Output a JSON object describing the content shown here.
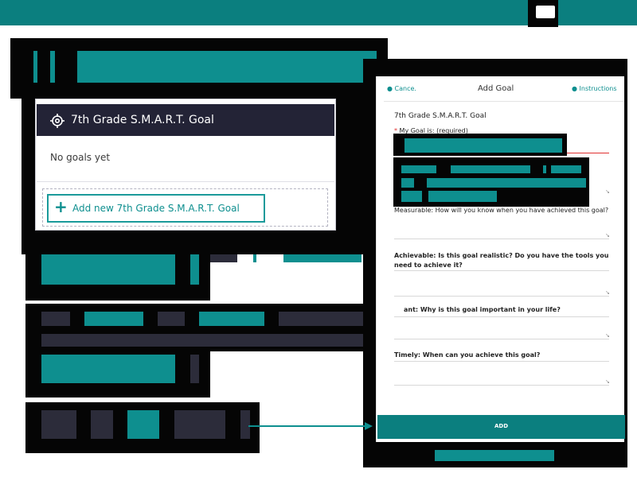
{
  "topbar": {
    "color": "#0b7f7f"
  },
  "goal_card": {
    "icon": "target-icon",
    "title": "7th Grade S.M.A.R.T. Goal",
    "empty_text": "No goals yet",
    "add_button_label": "Add new 7th Grade S.M.A.R.T. Goal"
  },
  "form": {
    "cancel_label": "Cance.",
    "title": "Add Goal",
    "instructions_label": "Instructions",
    "section_title": "7th Grade S.M.A.R.T. Goal",
    "required_mark": "*",
    "goal_label": "My Goal is: (required)",
    "measurable_label": "Measurable: How will you know when you have achieved this goal?",
    "achievable_label": "Achievable: Is this goal realistic? Do you have the tools you need to achieve it?",
    "relevant_label": "ant: Why is this goal important in your life?",
    "timely_label": "Timely: When can you achieve this goal?",
    "add_button_label": "ADD"
  },
  "colors": {
    "teal": "#0e8f8f",
    "dark": "#232336",
    "slate": "#2c2c3a",
    "highlight": "#fff200",
    "required": "#e03030"
  }
}
